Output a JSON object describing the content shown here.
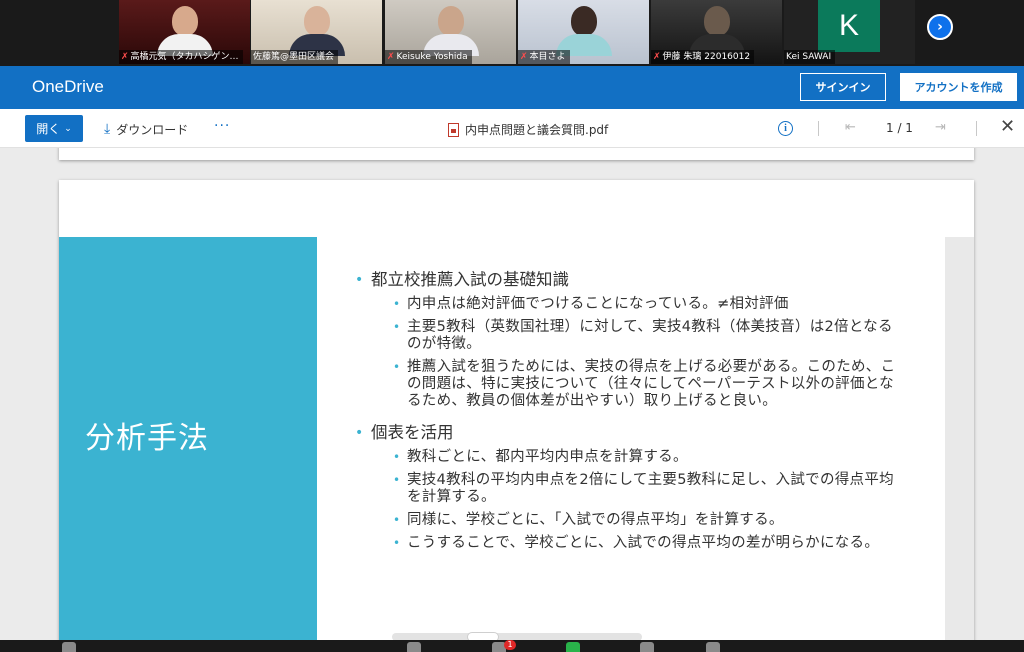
{
  "participants": [
    {
      "name": "高橋元気（タカハシゲン…",
      "muted": true,
      "active": false
    },
    {
      "name": "佐藤篤@墨田区議会",
      "muted": false,
      "active": true
    },
    {
      "name": "Keisuke Yoshida",
      "muted": true,
      "active": false
    },
    {
      "name": "本目さよ",
      "muted": true,
      "active": false
    },
    {
      "name": "伊藤 朱璃 22016012",
      "muted": true,
      "active": false
    },
    {
      "name": "Kei SAWAI",
      "muted": false,
      "active": false,
      "initial": "K"
    }
  ],
  "gallery_next_glyph": "›",
  "header": {
    "brand": "OneDrive",
    "signin_label": "サインイン",
    "create_label": "アカウントを作成"
  },
  "toolbar": {
    "open_label": "開く",
    "download_label": "ダウンロード",
    "more_label": "···",
    "file_name": "内申点問題と議会質問.pdf",
    "info_glyph": "i",
    "page_indicator": "1 / 1",
    "close_glyph": "✕"
  },
  "slide": {
    "title": "分析手法",
    "sections": [
      {
        "heading": "都立校推薦入試の基礎知識",
        "items": [
          "内申点は絶対評価でつけることになっている。≠相対評価",
          "主要5教科（英数国社理）に対して、実技4教科（体美技音）は2倍となるのが特徴。",
          "推薦入試を狙うためには、実技の得点を上げる必要がある。このため、この問題は、特に実技について（往々にしてペーパーテスト以外の評価となるため、教員の個体差が出やすい）取り上げると良い。"
        ]
      },
      {
        "heading": "個表を活用",
        "items": [
          "教科ごとに、都内平均内申点を計算する。",
          "実技4教科の平均内申点を2倍にして主要5教科に足し、入試での得点平均を計算する。",
          "同様に、学校ごとに、「入試での得点平均」を計算する。",
          "こうすることで、学校ごとに、入試での得点平均の差が明らかになる。"
        ]
      }
    ]
  },
  "bottom_bar": {
    "chat_badge": "1"
  },
  "colors": {
    "onedrive_blue": "#1270c4",
    "slide_accent": "#3bb3d1",
    "active_speaker": "#7cd15c"
  }
}
